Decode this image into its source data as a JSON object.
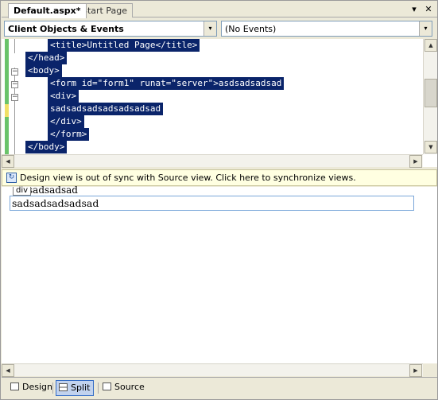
{
  "tabs": [
    {
      "label": "Default.aspx*",
      "active": true
    },
    {
      "label": "Start Page",
      "active": false
    }
  ],
  "tabstrip": {
    "dropdown_glyph": "▾",
    "close_glyph": "✕"
  },
  "dropdowns": {
    "objects": {
      "value": "Client Objects & Events",
      "arrow": "▾"
    },
    "events": {
      "value": "(No Events)",
      "arrow": "▾"
    }
  },
  "source": {
    "lines": [
      "<title>Untitled Page</title>",
      "</head>",
      "<body>",
      "<form id=\"form1\" runat=\"server\">asdsadsadsad",
      "<div>",
      "sadsadsadsadsadsadsad",
      "</div>",
      "</form>",
      "</body>"
    ],
    "fold_glyph": "−",
    "selection_color": "#0a246a"
  },
  "scroll_glyphs": {
    "up": "▲",
    "down": "▼",
    "left": "◀",
    "right": "▶"
  },
  "sync_bar": {
    "message": "Design view is out of sync with Source view. Click here to synchronize views.",
    "icon": "refresh-icon"
  },
  "design": {
    "div_tag": "div",
    "form_text": "sadsadsad",
    "div_text": "sadsadsadsadsad"
  },
  "view_tabs": [
    {
      "label": "Design",
      "icon": "design-icon",
      "selected": false
    },
    {
      "label": "Split",
      "icon": "split-icon",
      "selected": true
    },
    {
      "label": "Source",
      "icon": "source-icon",
      "selected": false
    }
  ]
}
